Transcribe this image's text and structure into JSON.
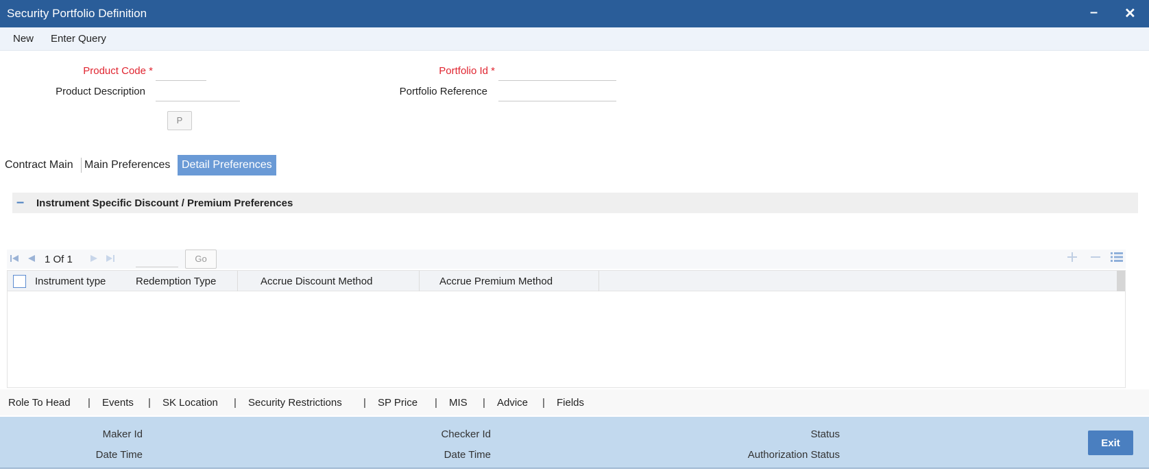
{
  "window": {
    "title": "Security Portfolio Definition",
    "minimize_glyph": "–",
    "close_glyph": "✕"
  },
  "menu": {
    "new_label": "New",
    "enter_query_label": "Enter Query"
  },
  "form": {
    "product_code_label": "Product Code",
    "product_code_value": "",
    "product_description_label": "Product Description",
    "product_description_value": "",
    "p_button_label": "P",
    "portfolio_id_label": "Portfolio Id",
    "portfolio_id_value": "",
    "portfolio_reference_label": "Portfolio Reference",
    "portfolio_reference_value": "",
    "required_marker": "*"
  },
  "tabs": [
    {
      "label": "Contract Main"
    },
    {
      "label": "Main Preferences"
    },
    {
      "label": "Detail Preferences",
      "active": true
    }
  ],
  "section": {
    "title": "Instrument Specific Discount / Premium Preferences",
    "collapse_glyph": "–"
  },
  "pager": {
    "page_info": "1 Of 1",
    "go_label": "Go",
    "page_input_value": ""
  },
  "grid": {
    "columns": [
      "Instrument type",
      "Redemption Type",
      "Accrue Discount Method",
      "Accrue Premium Method"
    ],
    "rows": []
  },
  "sublinks": [
    "Role To Head",
    "Events",
    "SK Location",
    "Security Restrictions",
    "SP Price",
    "MIS",
    "Advice",
    "Fields"
  ],
  "sublink_separator": "|",
  "footer": {
    "maker_id_label": "Maker Id",
    "maker_date_time_label": "Date Time",
    "checker_id_label": "Checker Id",
    "checker_date_time_label": "Date Time",
    "status_label": "Status",
    "authorization_status_label": "Authorization Status",
    "exit_label": "Exit"
  },
  "colors": {
    "title_bar": "#2a5d99",
    "active_tab": "#6a9ad6",
    "footer": "#c2d9ee",
    "exit_button": "#4a7fc0",
    "required": "#e0242f"
  },
  "icons": [
    "first-page-icon",
    "previous-page-icon",
    "next-page-icon",
    "last-page-icon",
    "add-row-icon",
    "delete-row-icon",
    "column-settings-icon"
  ]
}
